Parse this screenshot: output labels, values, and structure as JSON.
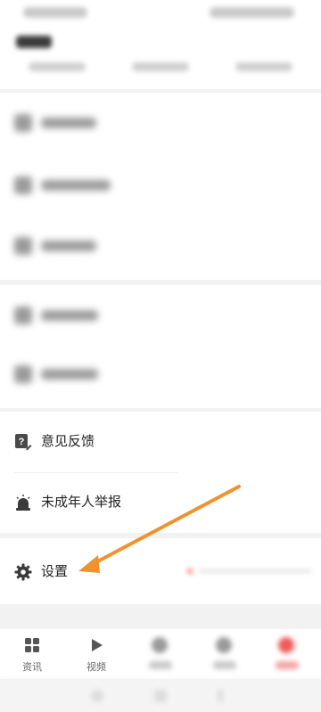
{
  "menu": {
    "feedback": {
      "label": "意见反馈",
      "icon": "feedback-icon"
    },
    "minor_report": {
      "label": "未成年人举报",
      "icon": "alarm-icon"
    },
    "settings": {
      "label": "设置",
      "icon": "gear-icon"
    }
  },
  "tabbar": {
    "tabs": [
      {
        "label": "资讯",
        "icon": "grid-icon"
      },
      {
        "label": "视频",
        "icon": "play-icon"
      }
    ]
  },
  "colors": {
    "arrow": "#f0922e",
    "active_tab": "#f05a5a"
  }
}
